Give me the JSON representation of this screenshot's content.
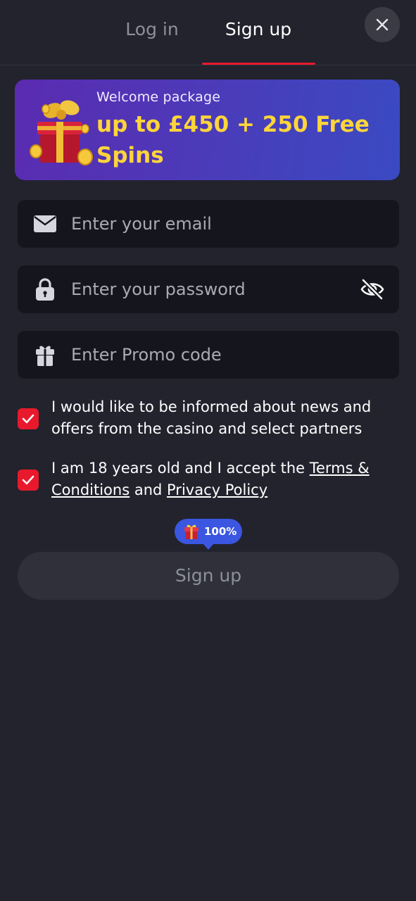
{
  "tabs": {
    "login": "Log in",
    "signup": "Sign up"
  },
  "banner": {
    "subtitle": "Welcome package",
    "title": "up to £450 + 250 Free Spins"
  },
  "form": {
    "email_placeholder": "Enter your email",
    "password_placeholder": "Enter your password",
    "promo_placeholder": "Enter Promo code"
  },
  "consent": {
    "news_text": "I would like to be informed about news and offers from the casino and select partners",
    "news_checked": true,
    "age_prefix": "I am 18 years old and I accept the ",
    "terms_link": "Terms & Conditions",
    "age_middle": " and ",
    "privacy_link": "Privacy Policy",
    "age_checked": true
  },
  "bonus_badge": {
    "value": "100%",
    "icon": "gift-icon"
  },
  "submit_label": "Sign up",
  "colors": {
    "background": "#22232d",
    "accent_red": "#e8192c",
    "banner_yellow": "#ffd53a",
    "badge_blue": "#3b56e0"
  },
  "icons": [
    "close-icon",
    "envelope-icon",
    "lock-icon",
    "eye-off-icon",
    "gift-icon",
    "checkmark-icon"
  ]
}
